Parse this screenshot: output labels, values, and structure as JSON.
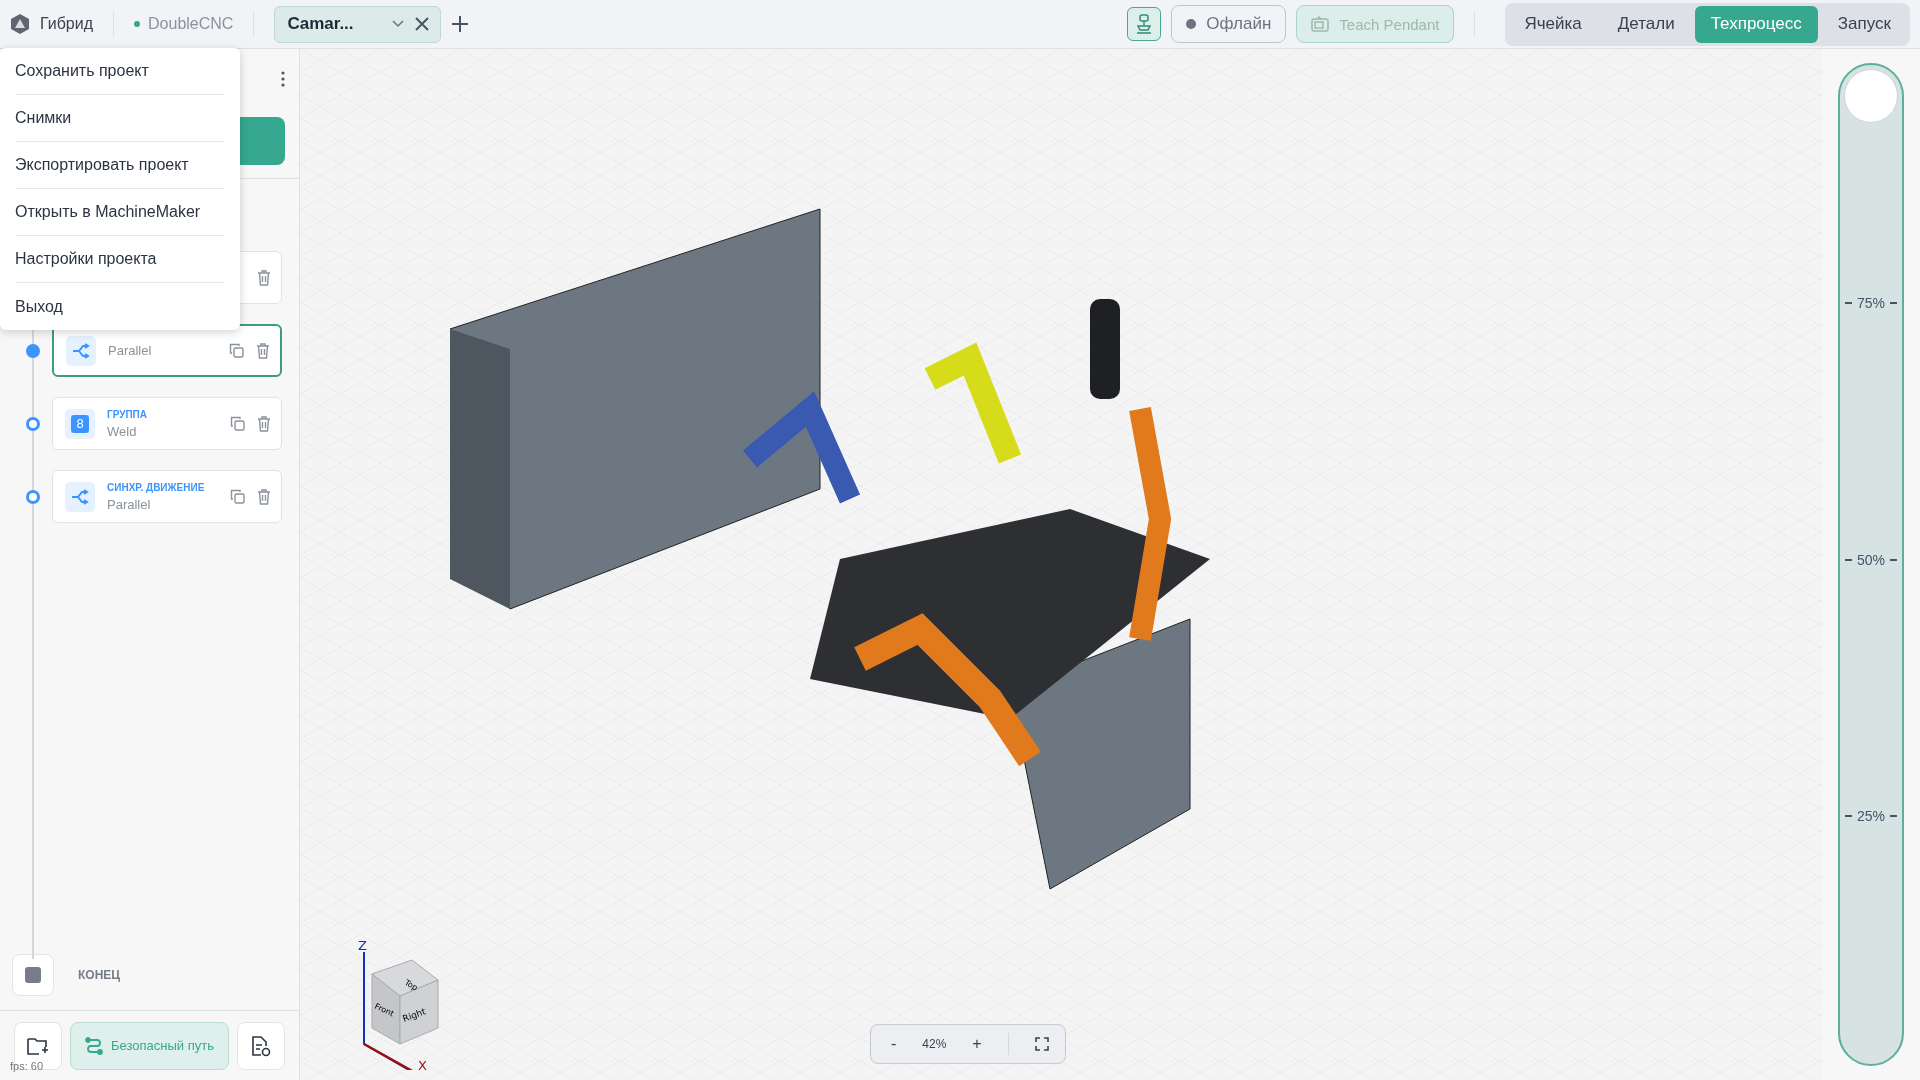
{
  "app": {
    "name": "Гибрид",
    "machine": "DoubleCNC",
    "machine_online": true
  },
  "project_tabs": [
    {
      "label": "Camar...",
      "selected": true
    }
  ],
  "toolbar": {
    "connection": "Офлайн",
    "teach_pendant": {
      "label": "Teach Pendant",
      "disabled": true
    }
  },
  "mode_tabs": [
    {
      "label": "Ячейка",
      "selected": false
    },
    {
      "label": "Детали",
      "selected": false
    },
    {
      "label": "Техпроцесс",
      "selected": true
    },
    {
      "label": "Запуск",
      "selected": false
    }
  ],
  "project_menu": {
    "items": [
      "Сохранить проект",
      "Снимки",
      "Экспортировать проект",
      "Открыть в MachineMaker",
      "Настройки проекта",
      "Выход"
    ]
  },
  "steps": [
    {
      "kind": "covered",
      "selected": false
    },
    {
      "kind": "parallel",
      "name": "Parallel",
      "selected": true
    },
    {
      "kind": "group",
      "type": "ГРУППА",
      "name": "Weld",
      "badge": "8",
      "selected": false
    },
    {
      "kind": "sync",
      "type": "СИНХР. ДВИЖЕНИЕ",
      "name": "Parallel",
      "selected": false
    }
  ],
  "end_step": {
    "label": "КОНЕЦ"
  },
  "footer": {
    "safe_path": "Безопасный путь",
    "fps": "fps: 60"
  },
  "viewport": {
    "zoom_out": "-",
    "zoom": "42%",
    "zoom_in": "+",
    "view_cube": {
      "top": "Top",
      "front": "Front",
      "right": "Right",
      "axis_z": "Z",
      "axis_x": "X"
    }
  },
  "speed_slider": {
    "level": 1,
    "ticks": [
      "75%",
      "50%",
      "25%"
    ]
  }
}
